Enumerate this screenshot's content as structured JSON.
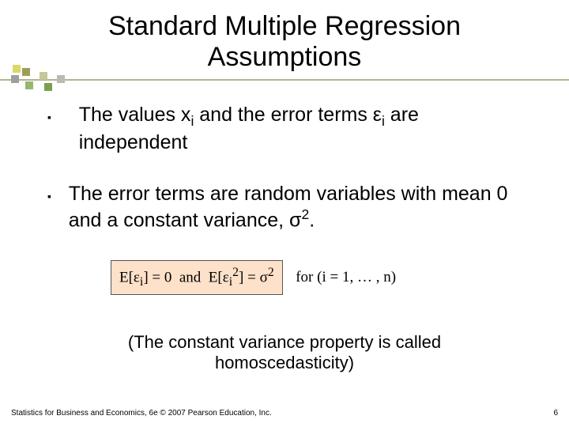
{
  "title_line1": "Standard Multiple Regression",
  "title_line2": "Assumptions",
  "bullets": [
    {
      "pre": "The values  x",
      "sub1": "i",
      "mid": " and the error terms  ε",
      "sub2": "i",
      "post": " are independent"
    },
    {
      "pre": "The error terms are random variables with mean 0 and a constant variance, σ",
      "sup": "2",
      "post": "."
    }
  ],
  "formula": {
    "eq_html": "E[ε<sub>i</sub>] = 0&nbsp;&nbsp;and&nbsp;&nbsp;E[ε<sub>i</sub><sup>2</sup>] = σ<sup>2</sup>",
    "note": "for (i = 1, … , n)"
  },
  "note_line1": "(The constant variance property is called",
  "note_line2": "homoscedasticity)",
  "footer": "Statistics for Business and Economics, 6e © 2007 Pearson Education, Inc.",
  "pagenum": "6"
}
